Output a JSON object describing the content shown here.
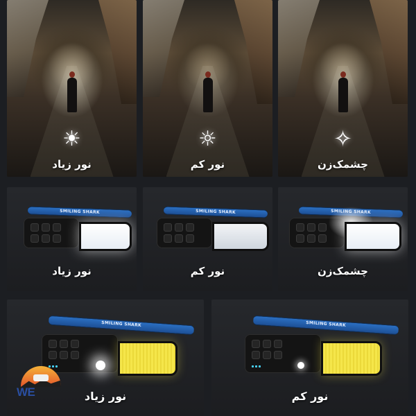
{
  "cave_tiles": [
    {
      "caption": "نور زیاد",
      "icon": "sun-icon"
    },
    {
      "caption": "نور کم",
      "icon": "sun-outline-icon"
    },
    {
      "caption": "چشمک‌زن",
      "icon": "star-sparkle-icon"
    }
  ],
  "lamp_tiles_row2": [
    {
      "caption": "نور زیاد",
      "mode": "bright-white"
    },
    {
      "caption": "نور کم",
      "mode": "dim-white"
    },
    {
      "caption": "چشمک‌زن",
      "mode": "flash-white"
    }
  ],
  "lamp_tiles_row3": [
    {
      "caption": "نور زیاد",
      "mode": "yellow-with-spot"
    },
    {
      "caption": "نور کم",
      "mode": "yellow-dim-spot"
    }
  ],
  "strap_text": "SMILING SHARK",
  "logo": {
    "text": "WE",
    "subtext": ""
  },
  "colors": {
    "background": "#1c1e22",
    "strap_blue": "#2b6fc2",
    "panel_yellow": "#f5e64a",
    "logo_red": "#e22e2e"
  }
}
